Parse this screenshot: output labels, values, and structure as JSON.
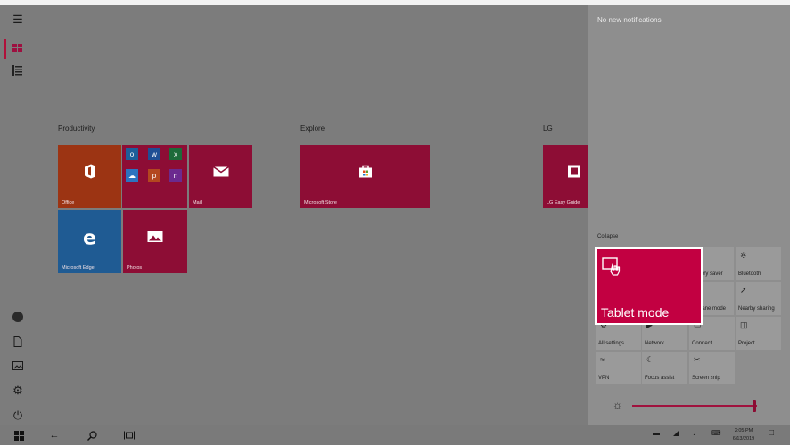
{
  "start": {
    "groups": [
      {
        "label": "Productivity"
      },
      {
        "label": "Explore"
      },
      {
        "label": "LG"
      }
    ],
    "tiles": {
      "office": "Office",
      "mail": "Mail",
      "store": "Microsoft Store",
      "lg_guide": "LG Easy Guide",
      "edge": "Microsoft Edge",
      "photos": "Photos"
    }
  },
  "action_center": {
    "title": "No new notifications",
    "collapse": "Collapse",
    "quick_actions": [
      {
        "label": "ery saver",
        "icon": "battery-saver-icon"
      },
      {
        "label": "Bluetooth",
        "icon": "bluetooth-icon"
      },
      {
        "label": "lane mode",
        "icon": "airplane-mode-icon"
      },
      {
        "label": "Nearby sharing",
        "icon": "nearby-sharing-icon"
      },
      {
        "label": "All settings",
        "icon": "settings-icon"
      },
      {
        "label": "Network",
        "icon": "network-icon"
      },
      {
        "label": "Connect",
        "icon": "connect-icon"
      },
      {
        "label": "Project",
        "icon": "project-icon"
      },
      {
        "label": "VPN",
        "icon": "vpn-icon"
      },
      {
        "label": "Focus assist",
        "icon": "focus-assist-icon"
      },
      {
        "label": "Screen snip",
        "icon": "screen-snip-icon"
      }
    ],
    "highlight": {
      "label": "Tablet mode",
      "icon": "tablet-mode-icon"
    },
    "brightness": {
      "value_fraction": 0.98
    }
  },
  "taskbar": {
    "time": "2:05 PM",
    "date": "6/13/2019"
  },
  "colors": {
    "accent": "#c20041",
    "tile_crimson": "#8d0d35",
    "office_orange": "#9c3413",
    "edge_blue": "#1f5b93"
  }
}
